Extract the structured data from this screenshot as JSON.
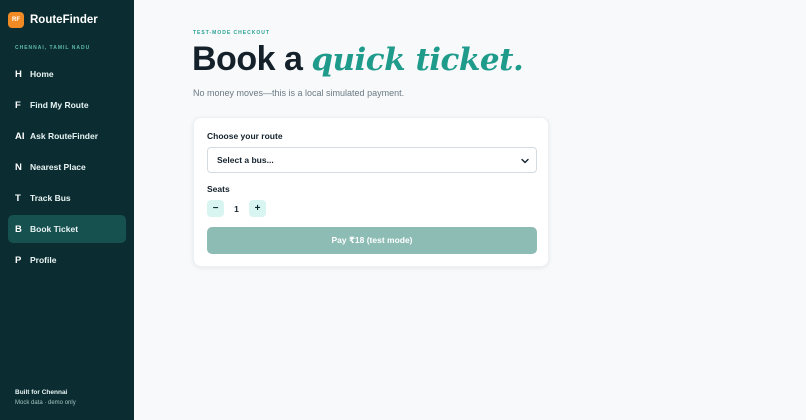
{
  "brand": {
    "logo_text": "RF",
    "name": "RouteFinder"
  },
  "city": "CHENNAI, TAMIL NADU",
  "sidebar": {
    "items": [
      {
        "key": "H",
        "label": "Home"
      },
      {
        "key": "F",
        "label": "Find My Route"
      },
      {
        "key": "AI",
        "label": "Ask RouteFinder"
      },
      {
        "key": "N",
        "label": "Nearest Place"
      },
      {
        "key": "T",
        "label": "Track Bus"
      },
      {
        "key": "B",
        "label": "Book Ticket",
        "active": true
      },
      {
        "key": "P",
        "label": "Profile"
      }
    ],
    "footer_title": "Built for Chennai",
    "footer_sub": "Mock data · demo only"
  },
  "page": {
    "eyebrow": "TEST-MODE CHECKOUT",
    "title_main": "Book a ",
    "title_accent": "quick ticket.",
    "subtitle": "No money moves—this is a local simulated payment."
  },
  "form": {
    "route_label": "Choose your route",
    "route_value": "Select a bus...",
    "seats_label": "Seats",
    "minus": "−",
    "seats_value": "1",
    "plus": "+",
    "pay_label": "Pay ₹18 (test mode)"
  },
  "colors": {
    "sidebar_bg": "#0b2d31",
    "accent": "#1f9b8c",
    "brand_orange": "#f08a24",
    "pay_disabled": "#8dbcb5"
  }
}
